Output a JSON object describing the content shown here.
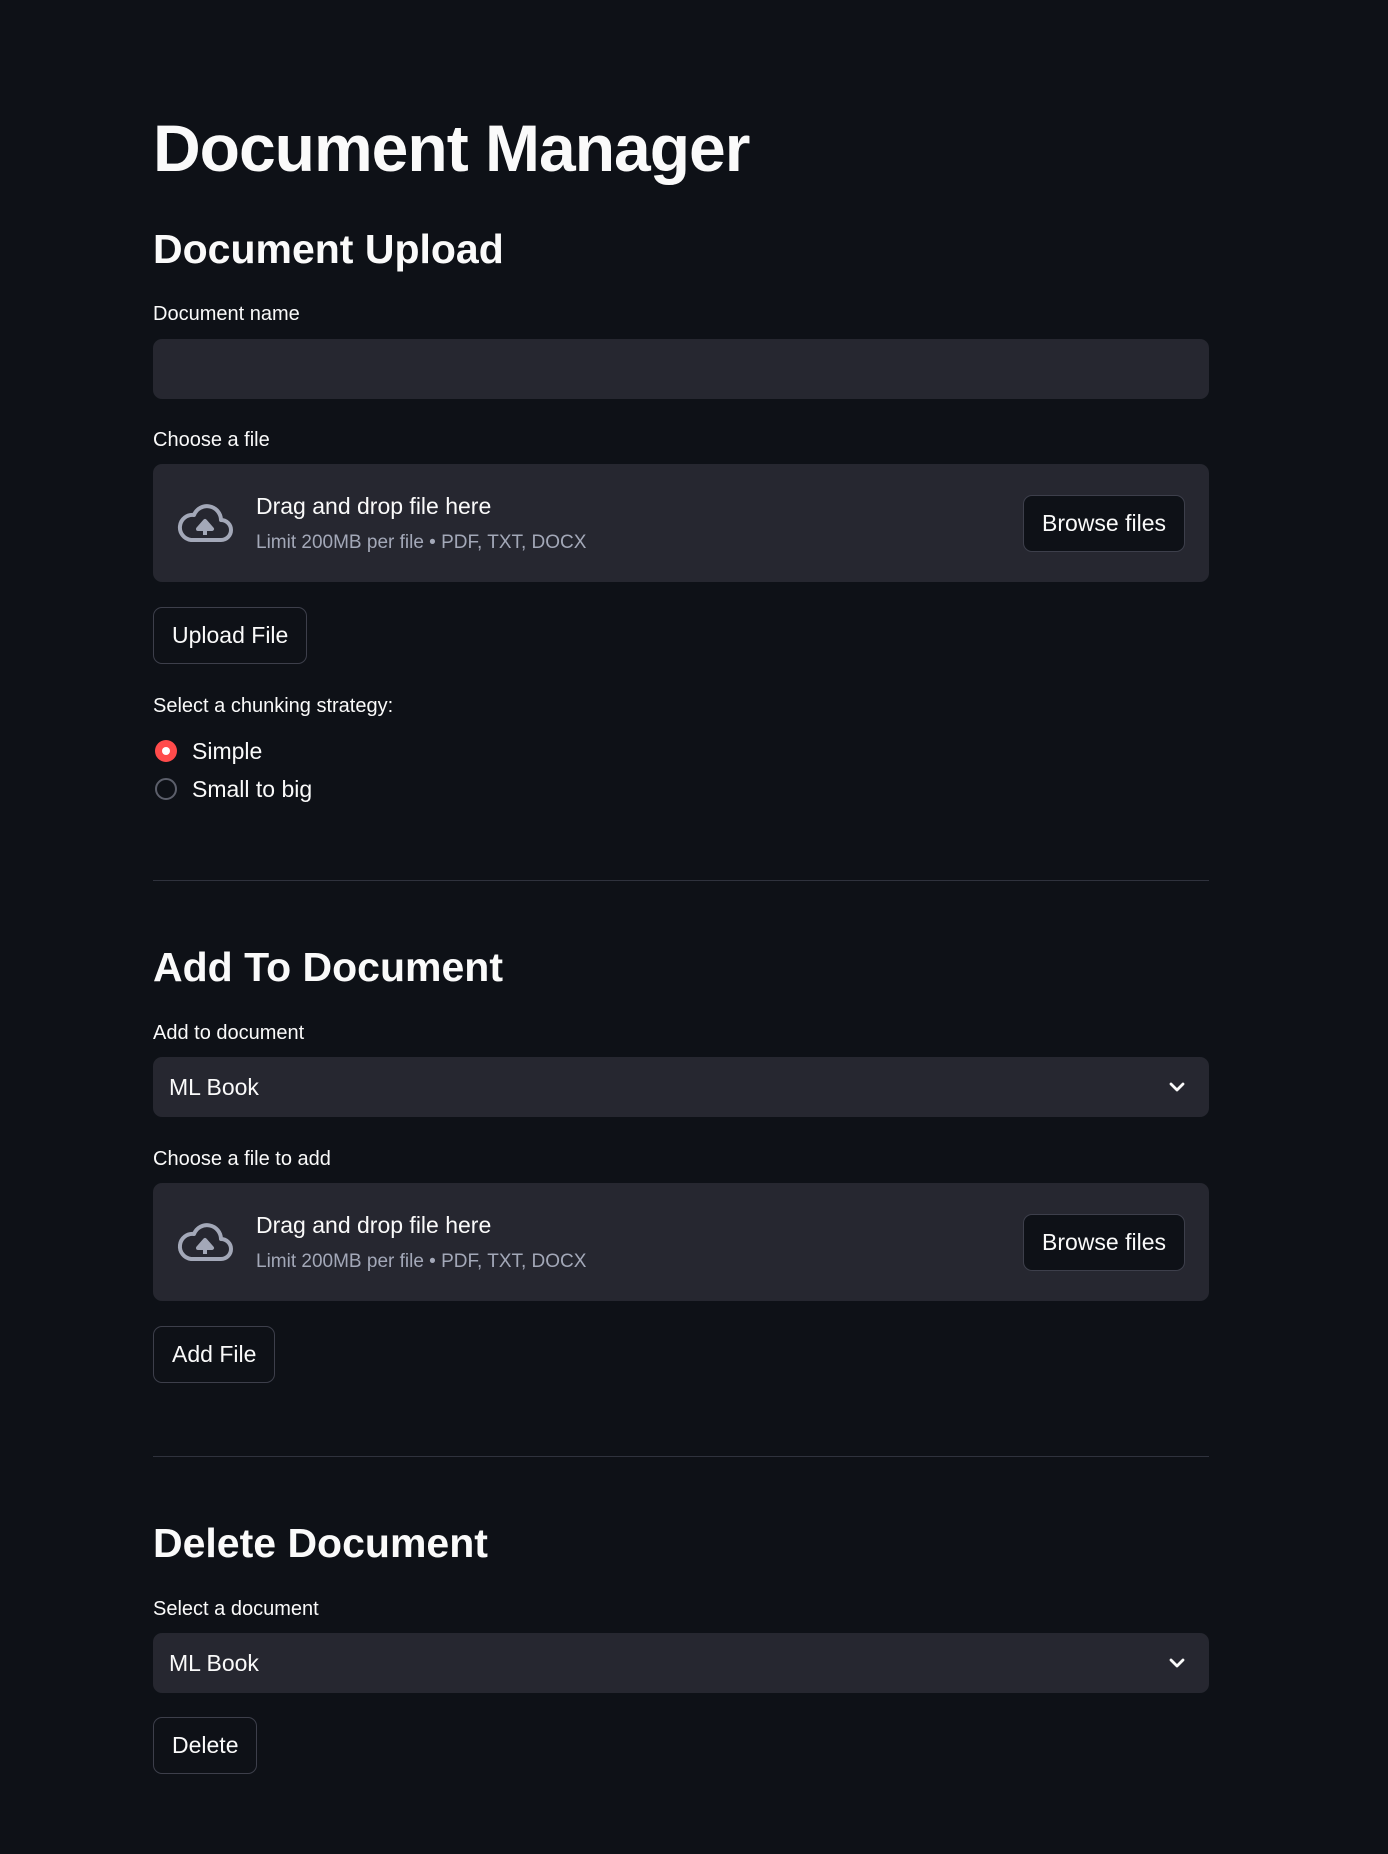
{
  "page": {
    "title": "Document Manager"
  },
  "upload": {
    "heading": "Document Upload",
    "name_label": "Document name",
    "name_value": "",
    "file_label": "Choose a file",
    "dropzone_title": "Drag and drop file here",
    "dropzone_subtitle": "Limit 200MB per file • PDF, TXT, DOCX",
    "browse_label": "Browse files",
    "upload_button": "Upload File",
    "chunking_label": "Select a chunking strategy:",
    "chunking_options": [
      {
        "label": "Simple",
        "selected": true
      },
      {
        "label": "Small to big",
        "selected": false
      }
    ]
  },
  "add": {
    "heading": "Add To Document",
    "select_label": "Add to document",
    "select_value": "ML Book",
    "file_label": "Choose a file to add",
    "dropzone_title": "Drag and drop file here",
    "dropzone_subtitle": "Limit 200MB per file • PDF, TXT, DOCX",
    "browse_label": "Browse files",
    "add_button": "Add File"
  },
  "delete": {
    "heading": "Delete Document",
    "select_label": "Select a document",
    "select_value": "ML Book",
    "delete_button": "Delete"
  },
  "icons": {
    "upload": "cloud-upload-icon",
    "dropdown": "chevron-down-icon"
  },
  "colors": {
    "background": "#0e1117",
    "surface": "#262730",
    "accent": "#ff4b4b",
    "text": "#fafafa",
    "muted": "#a3a8b8"
  }
}
